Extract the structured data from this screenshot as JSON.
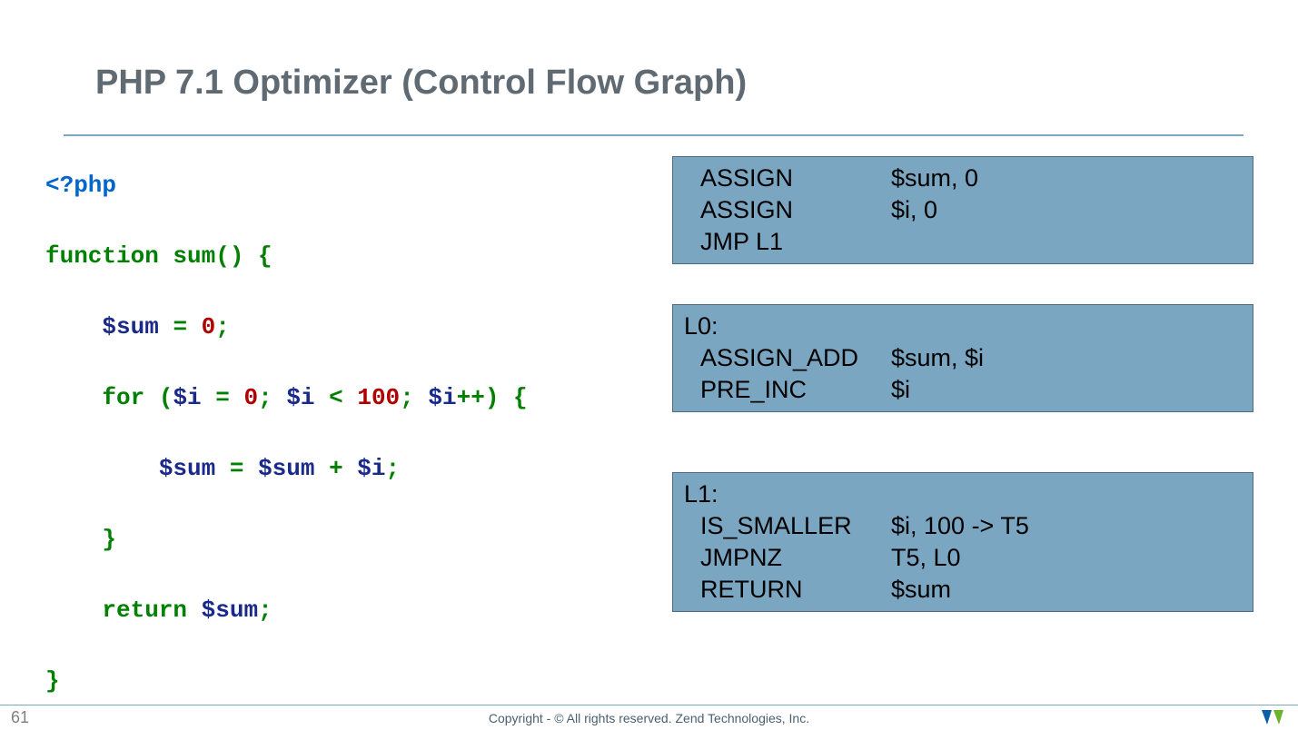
{
  "title": "PHP 7.1 Optimizer (Control Flow Graph)",
  "code": {
    "l1": "<?php",
    "l2_kw": "function",
    "l2_fn": " sum",
    "l2_rest": "() {",
    "l3_var": "$sum",
    "l3_eq": " = ",
    "l3_num": "0",
    "l3_semi": ";",
    "l4_for": "for",
    "l4_op": " (",
    "l4_v1": "$i",
    "l4_a1": " = ",
    "l4_n1": "0",
    "l4_s1": "; ",
    "l4_v2": "$i",
    "l4_lt": " < ",
    "l4_n2": "100",
    "l4_s2": "; ",
    "l4_v3": "$i",
    "l4_inc": "++",
    "l4_cp": ") {",
    "l5_v1": "$sum",
    "l5_eq": " = ",
    "l5_v2": "$sum",
    "l5_plus": " + ",
    "l5_v3": "$i",
    "l5_semi": ";",
    "l6": "}",
    "l7_kw": "return",
    "l7_var": " $sum",
    "l7_semi": ";",
    "l8": "}"
  },
  "blocks": {
    "b1": {
      "rows": [
        {
          "op": "ASSIGN",
          "args": "$sum, 0"
        },
        {
          "op": "ASSIGN",
          "args": "$i, 0"
        },
        {
          "op": "JMP L1",
          "args": ""
        }
      ]
    },
    "b2": {
      "label": "L0:",
      "rows": [
        {
          "op": "ASSIGN_ADD",
          "args": "$sum, $i"
        },
        {
          "op": "PRE_INC",
          "args": "$i"
        }
      ]
    },
    "b3": {
      "label": "L1:",
      "rows": [
        {
          "op": "IS_SMALLER",
          "args": "$i, 100 -> T5"
        },
        {
          "op": "JMPNZ",
          "args": "T5, L0"
        },
        {
          "op": "RETURN",
          "args": "$sum"
        }
      ]
    }
  },
  "footer": {
    "page": "61",
    "copyright": "Copyright - © All rights reserved. Zend Technologies, Inc."
  },
  "colors": {
    "block_bg": "#7aa6c2",
    "title_color": "#5f6a72"
  }
}
